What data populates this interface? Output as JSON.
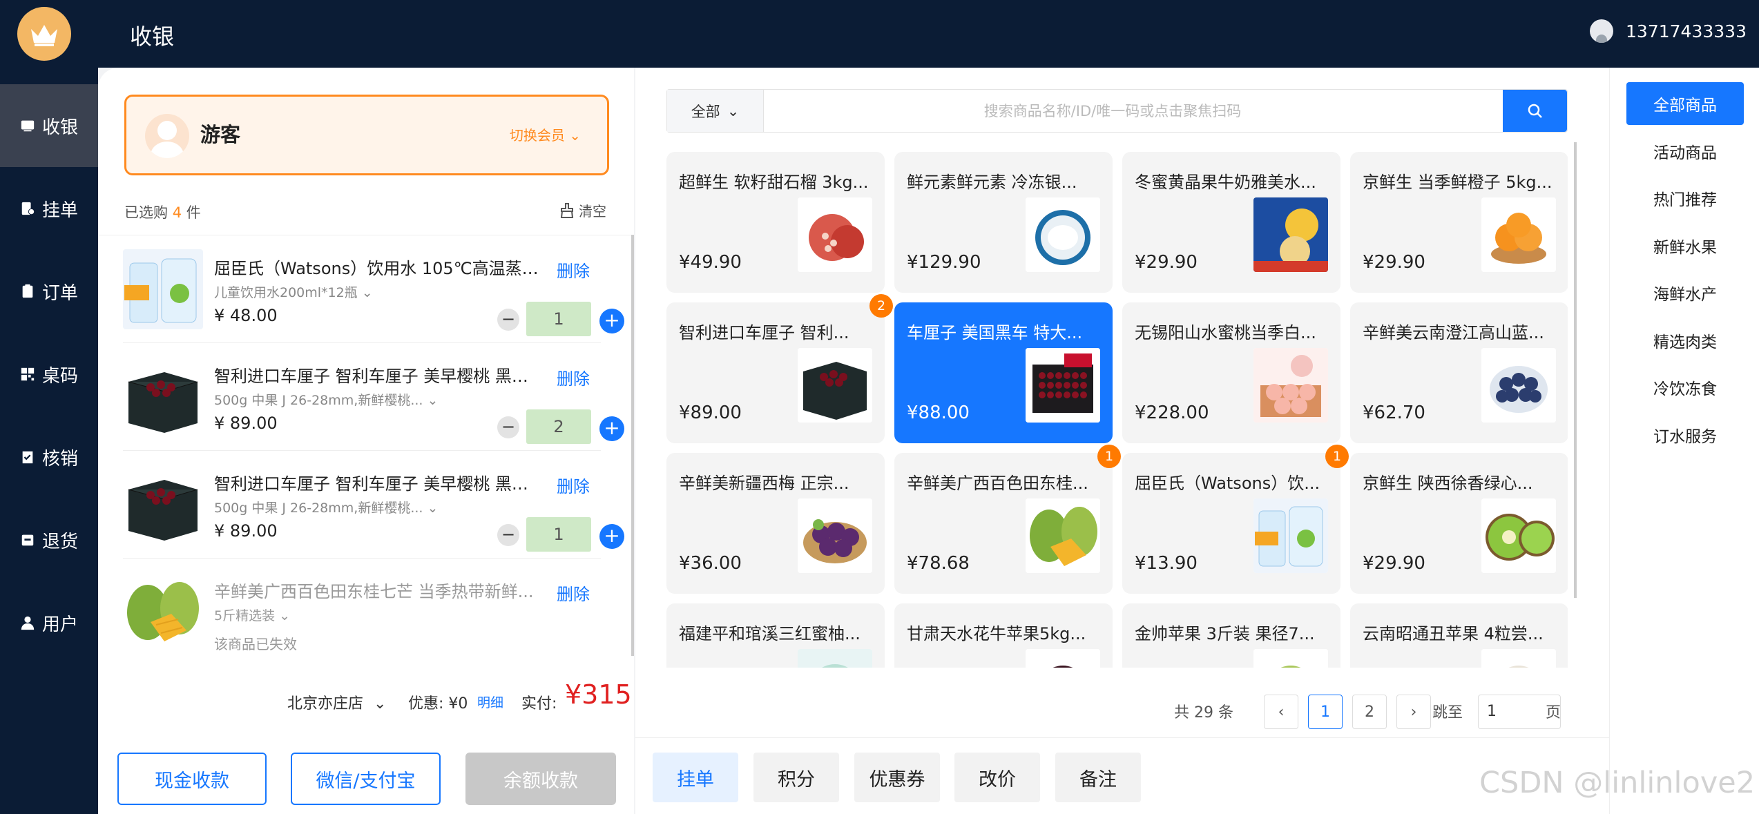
{
  "header": {
    "title": "收银",
    "user_phone": "13717433333"
  },
  "sidebar": {
    "items": [
      {
        "label": "收银",
        "icon": "cashier-icon",
        "active": true
      },
      {
        "label": "挂单",
        "icon": "hold-order-icon"
      },
      {
        "label": "订单",
        "icon": "order-icon"
      },
      {
        "label": "桌码",
        "icon": "qrcode-icon"
      },
      {
        "label": "核销",
        "icon": "verify-icon"
      },
      {
        "label": "退货",
        "icon": "return-icon"
      },
      {
        "label": "用户",
        "icon": "user-icon"
      }
    ]
  },
  "member": {
    "name": "游客",
    "switch_label": "切换会员"
  },
  "cart": {
    "selected_prefix": "已选购",
    "selected_count": "4",
    "selected_suffix": "件",
    "clear_label": "清空",
    "items": [
      {
        "title": "屈臣氏（Watsons）饮用水 105℃高温蒸馏...",
        "spec": "儿童饮用水200ml*12瓶",
        "price": "¥ 48.00",
        "qty": "1",
        "delete": "删除"
      },
      {
        "title": "智利进口车厘子 智利车厘子 美早樱桃 黑珍...",
        "spec": "500g 中果 J 26-28mm,新鲜樱桃...",
        "price": "¥ 89.00",
        "qty": "2",
        "delete": "删除"
      },
      {
        "title": "智利进口车厘子 智利车厘子 美早樱桃 黑珍...",
        "spec": "500g 中果 J 26-28mm,新鲜樱桃...",
        "price": "¥ 89.00",
        "qty": "1",
        "delete": "删除"
      },
      {
        "title": "辛鲜美广西百色田东桂七芒 当季热带新鲜...",
        "spec": "5斤精选装",
        "status": "该商品已失效",
        "delete": "删除"
      }
    ]
  },
  "summary": {
    "store": "北京亦庄店",
    "discount_label": "优惠: ¥0",
    "detail_label": "明细",
    "paid_label": "实付:",
    "paid_value": "¥315"
  },
  "payment": {
    "cash": "现金收款",
    "wechat": "微信/支付宝",
    "balance": "余额收款"
  },
  "search": {
    "category": "全部",
    "placeholder": "搜索商品名称/ID/唯一码或点击聚焦扫码"
  },
  "products": [
    {
      "title": "超鲜生 软籽甜石榴 3kg...",
      "price": "¥49.90",
      "img": "pomegranate"
    },
    {
      "title": "鲜元素鲜元素 冷冻银...",
      "price": "¥129.90",
      "img": "fish"
    },
    {
      "title": "冬蜜黄晶果牛奶雅美水...",
      "price": "¥29.90",
      "img": "yellowfruit"
    },
    {
      "title": "京鲜生 当季鲜橙子 5kg...",
      "price": "¥29.90",
      "img": "orange"
    },
    {
      "title": "智利进口车厘子 智利...",
      "price": "¥89.00",
      "img": "cherry",
      "badge": "2"
    },
    {
      "title": "车厘子 美国黑车 特大...",
      "price": "¥88.00",
      "img": "cherrybox",
      "active": true
    },
    {
      "title": "无锡阳山水蜜桃当季白...",
      "price": "¥228.00",
      "img": "peach"
    },
    {
      "title": "辛鲜美云南澄江高山蓝...",
      "price": "¥62.70",
      "img": "blueberry"
    },
    {
      "title": "辛鲜美新疆西梅 正宗...",
      "price": "¥36.00",
      "img": "plum"
    },
    {
      "title": "辛鲜美广西百色田东桂...",
      "price": "¥78.68",
      "img": "mango",
      "badge": "1"
    },
    {
      "title": "屈臣氏（Watsons）饮...",
      "price": "¥13.90",
      "img": "water",
      "badge": "1"
    },
    {
      "title": "京鲜生 陕西徐香绿心...",
      "price": "¥29.90",
      "img": "kiwi"
    },
    {
      "title": "福建平和琯溪三红蜜柚...",
      "price": "",
      "img": "pomelo"
    },
    {
      "title": "甘肃天水花牛苹果5kg...",
      "price": "",
      "img": "apple-red"
    },
    {
      "title": "金帅苹果 3斤装 果径7...",
      "price": "",
      "img": "apple-green"
    },
    {
      "title": "云南昭通丑苹果 4粒尝...",
      "price": "",
      "img": "apple-ugly"
    }
  ],
  "pagination": {
    "total": "共 29 条",
    "pages": [
      "1",
      "2"
    ],
    "current": "1",
    "jump_label": "跳至",
    "jump_value": "1",
    "unit": "页"
  },
  "actions": {
    "hold": "挂单",
    "points": "积分",
    "coupon": "优惠券",
    "reprice": "改价",
    "note": "备注"
  },
  "categories": [
    "全部商品",
    "活动商品",
    "热门推荐",
    "新鲜水果",
    "海鲜水产",
    "精选肉类",
    "冷饮冻食",
    "订水服务"
  ],
  "watermark": "CSDN @linlinlove2",
  "colors": {
    "primary": "#1677ff",
    "nav_bg": "#0b1c35",
    "accent": "#ff8a1f",
    "price_red": "#e02020"
  }
}
